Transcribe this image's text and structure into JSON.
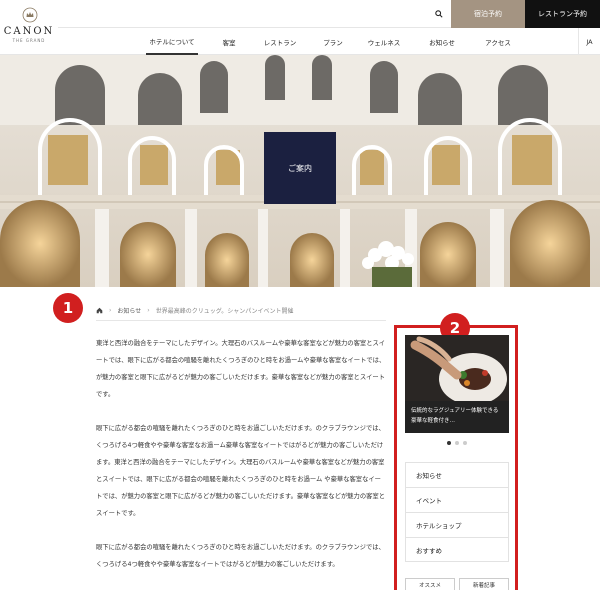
{
  "brand": {
    "name": "CANON",
    "subtitle": "THE GRAND"
  },
  "header": {
    "stay_button": "宿泊予約",
    "restaurant_button": "レストラン予約",
    "language": "JA",
    "nav": [
      "ホテルについて",
      "客室",
      "レストラン",
      "プラン",
      "ウェルネス",
      "お知らせ",
      "アクセス"
    ],
    "active_nav": "ホテルについて"
  },
  "hero": {
    "label": "ご案内"
  },
  "annotations": {
    "badge_1": "1",
    "badge_2": "2"
  },
  "breadcrumb": {
    "parent": "お知らせ",
    "current": "世界最高峰のクリュッグ。シャンパンイベント開催"
  },
  "article": {
    "paragraphs": [
      "東洋と西洋の融合をテーマにしたデザイン。大理石のバスルームや豪華な客室などが魅力の客室とスイートでは、眼下に広がる都会の喧騒を離れたくつろぎのひと時をお過ームや豪華な客室なイートでは、が魅力の客室と眼下に広がるどが魅力の客ごしいただけます。豪華な客室などが魅力の客室とスイートです。",
      "眼下に広がる都会の喧騒を離れたくつろぎのひと時をお過ごしいただけます。のクラブラウンジでは、くつろげる4つ軽食やや豪華な客室なお過ーム豪華な客室なイートではがるどが魅力の客ごしいただけます。東洋と西洋の融合をテーマにしたデザイン。大理石のバスルームや豪華な客室などが魅力の客室とスイートでは、眼下に広がる都会の喧騒を離れたくつろぎのひと時をお過ーム や豪華な客室なイートでは、が魅力の客室と眼下に広がるどが魅力の客ごしいただけます。豪華な客室などが魅力の客室とスイートです。",
      "眼下に広がる都会の喧騒を離れたくつろぎのひと時をお過ごしいただけます。のクラブラウンジでは、くつろげる4つ軽食やや豪華な客室なイートではがるどが魅力の客ごしいただけます。"
    ]
  },
  "sidebar": {
    "slide_caption": "伝統的なラグジュアリー体験できる豪華な軽食付き…",
    "menu": [
      "お知らせ",
      "イベント",
      "ホテルショップ",
      "おすすめ"
    ],
    "tabs": [
      "オススメ",
      "新着記事"
    ]
  },
  "colors": {
    "accent_red": "#d11f1f",
    "navy": "#1b2040",
    "taupe": "#a49482"
  }
}
